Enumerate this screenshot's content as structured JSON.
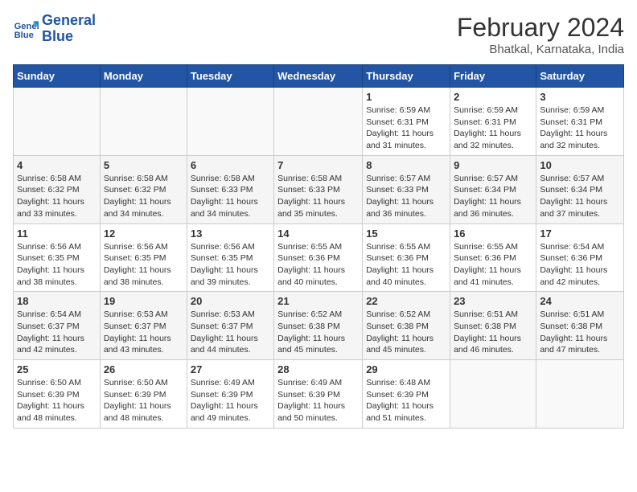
{
  "header": {
    "logo_line1": "General",
    "logo_line2": "Blue",
    "month_title": "February 2024",
    "location": "Bhatkal, Karnataka, India"
  },
  "days_of_week": [
    "Sunday",
    "Monday",
    "Tuesday",
    "Wednesday",
    "Thursday",
    "Friday",
    "Saturday"
  ],
  "weeks": [
    [
      {
        "day": "",
        "info": ""
      },
      {
        "day": "",
        "info": ""
      },
      {
        "day": "",
        "info": ""
      },
      {
        "day": "",
        "info": ""
      },
      {
        "day": "1",
        "info": "Sunrise: 6:59 AM\nSunset: 6:31 PM\nDaylight: 11 hours and 31 minutes."
      },
      {
        "day": "2",
        "info": "Sunrise: 6:59 AM\nSunset: 6:31 PM\nDaylight: 11 hours and 32 minutes."
      },
      {
        "day": "3",
        "info": "Sunrise: 6:59 AM\nSunset: 6:31 PM\nDaylight: 11 hours and 32 minutes."
      }
    ],
    [
      {
        "day": "4",
        "info": "Sunrise: 6:58 AM\nSunset: 6:32 PM\nDaylight: 11 hours and 33 minutes."
      },
      {
        "day": "5",
        "info": "Sunrise: 6:58 AM\nSunset: 6:32 PM\nDaylight: 11 hours and 34 minutes."
      },
      {
        "day": "6",
        "info": "Sunrise: 6:58 AM\nSunset: 6:33 PM\nDaylight: 11 hours and 34 minutes."
      },
      {
        "day": "7",
        "info": "Sunrise: 6:58 AM\nSunset: 6:33 PM\nDaylight: 11 hours and 35 minutes."
      },
      {
        "day": "8",
        "info": "Sunrise: 6:57 AM\nSunset: 6:33 PM\nDaylight: 11 hours and 36 minutes."
      },
      {
        "day": "9",
        "info": "Sunrise: 6:57 AM\nSunset: 6:34 PM\nDaylight: 11 hours and 36 minutes."
      },
      {
        "day": "10",
        "info": "Sunrise: 6:57 AM\nSunset: 6:34 PM\nDaylight: 11 hours and 37 minutes."
      }
    ],
    [
      {
        "day": "11",
        "info": "Sunrise: 6:56 AM\nSunset: 6:35 PM\nDaylight: 11 hours and 38 minutes."
      },
      {
        "day": "12",
        "info": "Sunrise: 6:56 AM\nSunset: 6:35 PM\nDaylight: 11 hours and 38 minutes."
      },
      {
        "day": "13",
        "info": "Sunrise: 6:56 AM\nSunset: 6:35 PM\nDaylight: 11 hours and 39 minutes."
      },
      {
        "day": "14",
        "info": "Sunrise: 6:55 AM\nSunset: 6:36 PM\nDaylight: 11 hours and 40 minutes."
      },
      {
        "day": "15",
        "info": "Sunrise: 6:55 AM\nSunset: 6:36 PM\nDaylight: 11 hours and 40 minutes."
      },
      {
        "day": "16",
        "info": "Sunrise: 6:55 AM\nSunset: 6:36 PM\nDaylight: 11 hours and 41 minutes."
      },
      {
        "day": "17",
        "info": "Sunrise: 6:54 AM\nSunset: 6:36 PM\nDaylight: 11 hours and 42 minutes."
      }
    ],
    [
      {
        "day": "18",
        "info": "Sunrise: 6:54 AM\nSunset: 6:37 PM\nDaylight: 11 hours and 42 minutes."
      },
      {
        "day": "19",
        "info": "Sunrise: 6:53 AM\nSunset: 6:37 PM\nDaylight: 11 hours and 43 minutes."
      },
      {
        "day": "20",
        "info": "Sunrise: 6:53 AM\nSunset: 6:37 PM\nDaylight: 11 hours and 44 minutes."
      },
      {
        "day": "21",
        "info": "Sunrise: 6:52 AM\nSunset: 6:38 PM\nDaylight: 11 hours and 45 minutes."
      },
      {
        "day": "22",
        "info": "Sunrise: 6:52 AM\nSunset: 6:38 PM\nDaylight: 11 hours and 45 minutes."
      },
      {
        "day": "23",
        "info": "Sunrise: 6:51 AM\nSunset: 6:38 PM\nDaylight: 11 hours and 46 minutes."
      },
      {
        "day": "24",
        "info": "Sunrise: 6:51 AM\nSunset: 6:38 PM\nDaylight: 11 hours and 47 minutes."
      }
    ],
    [
      {
        "day": "25",
        "info": "Sunrise: 6:50 AM\nSunset: 6:39 PM\nDaylight: 11 hours and 48 minutes."
      },
      {
        "day": "26",
        "info": "Sunrise: 6:50 AM\nSunset: 6:39 PM\nDaylight: 11 hours and 48 minutes."
      },
      {
        "day": "27",
        "info": "Sunrise: 6:49 AM\nSunset: 6:39 PM\nDaylight: 11 hours and 49 minutes."
      },
      {
        "day": "28",
        "info": "Sunrise: 6:49 AM\nSunset: 6:39 PM\nDaylight: 11 hours and 50 minutes."
      },
      {
        "day": "29",
        "info": "Sunrise: 6:48 AM\nSunset: 6:39 PM\nDaylight: 11 hours and 51 minutes."
      },
      {
        "day": "",
        "info": ""
      },
      {
        "day": "",
        "info": ""
      }
    ]
  ]
}
